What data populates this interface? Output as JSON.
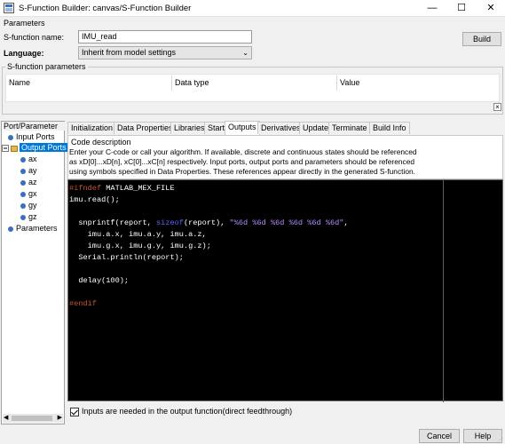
{
  "window": {
    "title": "S-Function Builder: canvas/S-Function Builder",
    "minimize": "—",
    "maximize": "☐",
    "close": "✕"
  },
  "parameters": {
    "header": "Parameters",
    "sfunction_name_label": "S-function name:",
    "sfunction_name_value": "IMU_read",
    "language_label": "Language:",
    "language_value": "Inherit from model settings",
    "build_label": "Build"
  },
  "sfunction_parameters": {
    "label": "S-function parameters",
    "columns": [
      "Name",
      "Data type",
      "Value"
    ]
  },
  "port_parameter": {
    "title": "Port/Parameter",
    "input_ports": "Input Ports",
    "output_ports": "Output Ports",
    "outputs": [
      "ax",
      "ay",
      "az",
      "gx",
      "gy",
      "gz"
    ],
    "parameters": "Parameters"
  },
  "tabs": [
    "Initialization",
    "Data Properties",
    "Libraries",
    "Start",
    "Outputs",
    "Derivatives",
    "Update",
    "Terminate",
    "Build Info"
  ],
  "active_tab": "Outputs",
  "code_description": {
    "label": "Code description",
    "line1": "Enter your C-code or call your algorithm. If available, discrete and continuous states should be referenced",
    "line2": "as xD[0]...xD[n], xC[0]...xC[n] respectively. Input ports, output ports and parameters should be referenced",
    "line3": "using symbols specified in Data Properties. These references appear directly in the generated S-function."
  },
  "code": {
    "l1_kw": "#ifndef",
    "l1_rest": " MATLAB_MEX_FILE",
    "l2": "imu.read();",
    "l4_a": "  snprintf(report, ",
    "l4_fn": "sizeof",
    "l4_b": "(report), ",
    "l4_str": "\"%6d %6d %6d %6d %6d %6d\"",
    "l4_c": ",",
    "l5": "    imu.a.x, imu.a.y, imu.a.z,",
    "l6": "    imu.g.x, imu.g.y, imu.g.z);",
    "l7": "  Serial.println(report);",
    "l9": "  delay(100);",
    "l11": "#endif"
  },
  "feedthrough_label": "Inputs are needed in the output function(direct feedthrough)",
  "footer": {
    "cancel": "Cancel",
    "help": "Help"
  }
}
